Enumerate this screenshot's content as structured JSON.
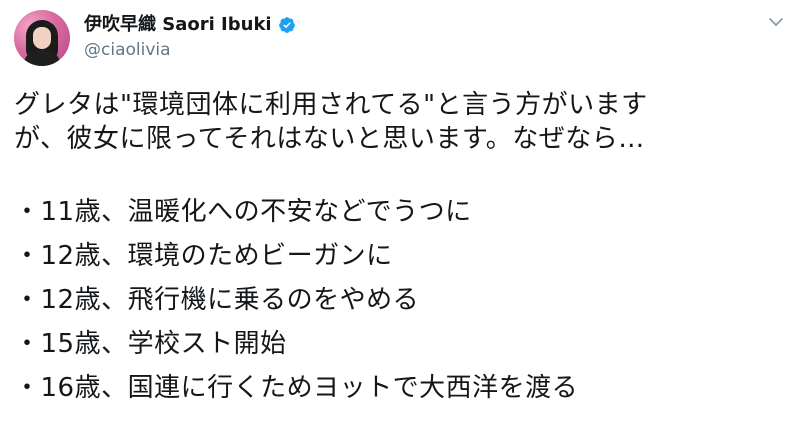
{
  "tweet": {
    "display_name": "伊吹早織 Saori Ibuki",
    "handle": "@ciaolivia",
    "lines": [
      "グレタは\"環境団体に利用されてる\"と言う方がいます",
      "が、彼女に限ってそれはないと思います。なぜなら…"
    ],
    "items": [
      "・11歳、温暖化への不安などでうつに",
      "・12歳、環境のためビーガンに",
      "・12歳、飛行機に乗るのをやめる",
      "・15歳、学校スト開始",
      "・16歳、国連に行くためヨットで大西洋を渡る"
    ]
  },
  "icons": {
    "verified": "verified-badge-icon",
    "menu": "chevron-down-icon"
  },
  "colors": {
    "verified": "#1da1f2",
    "handle": "#657786",
    "text": "#14171a"
  }
}
